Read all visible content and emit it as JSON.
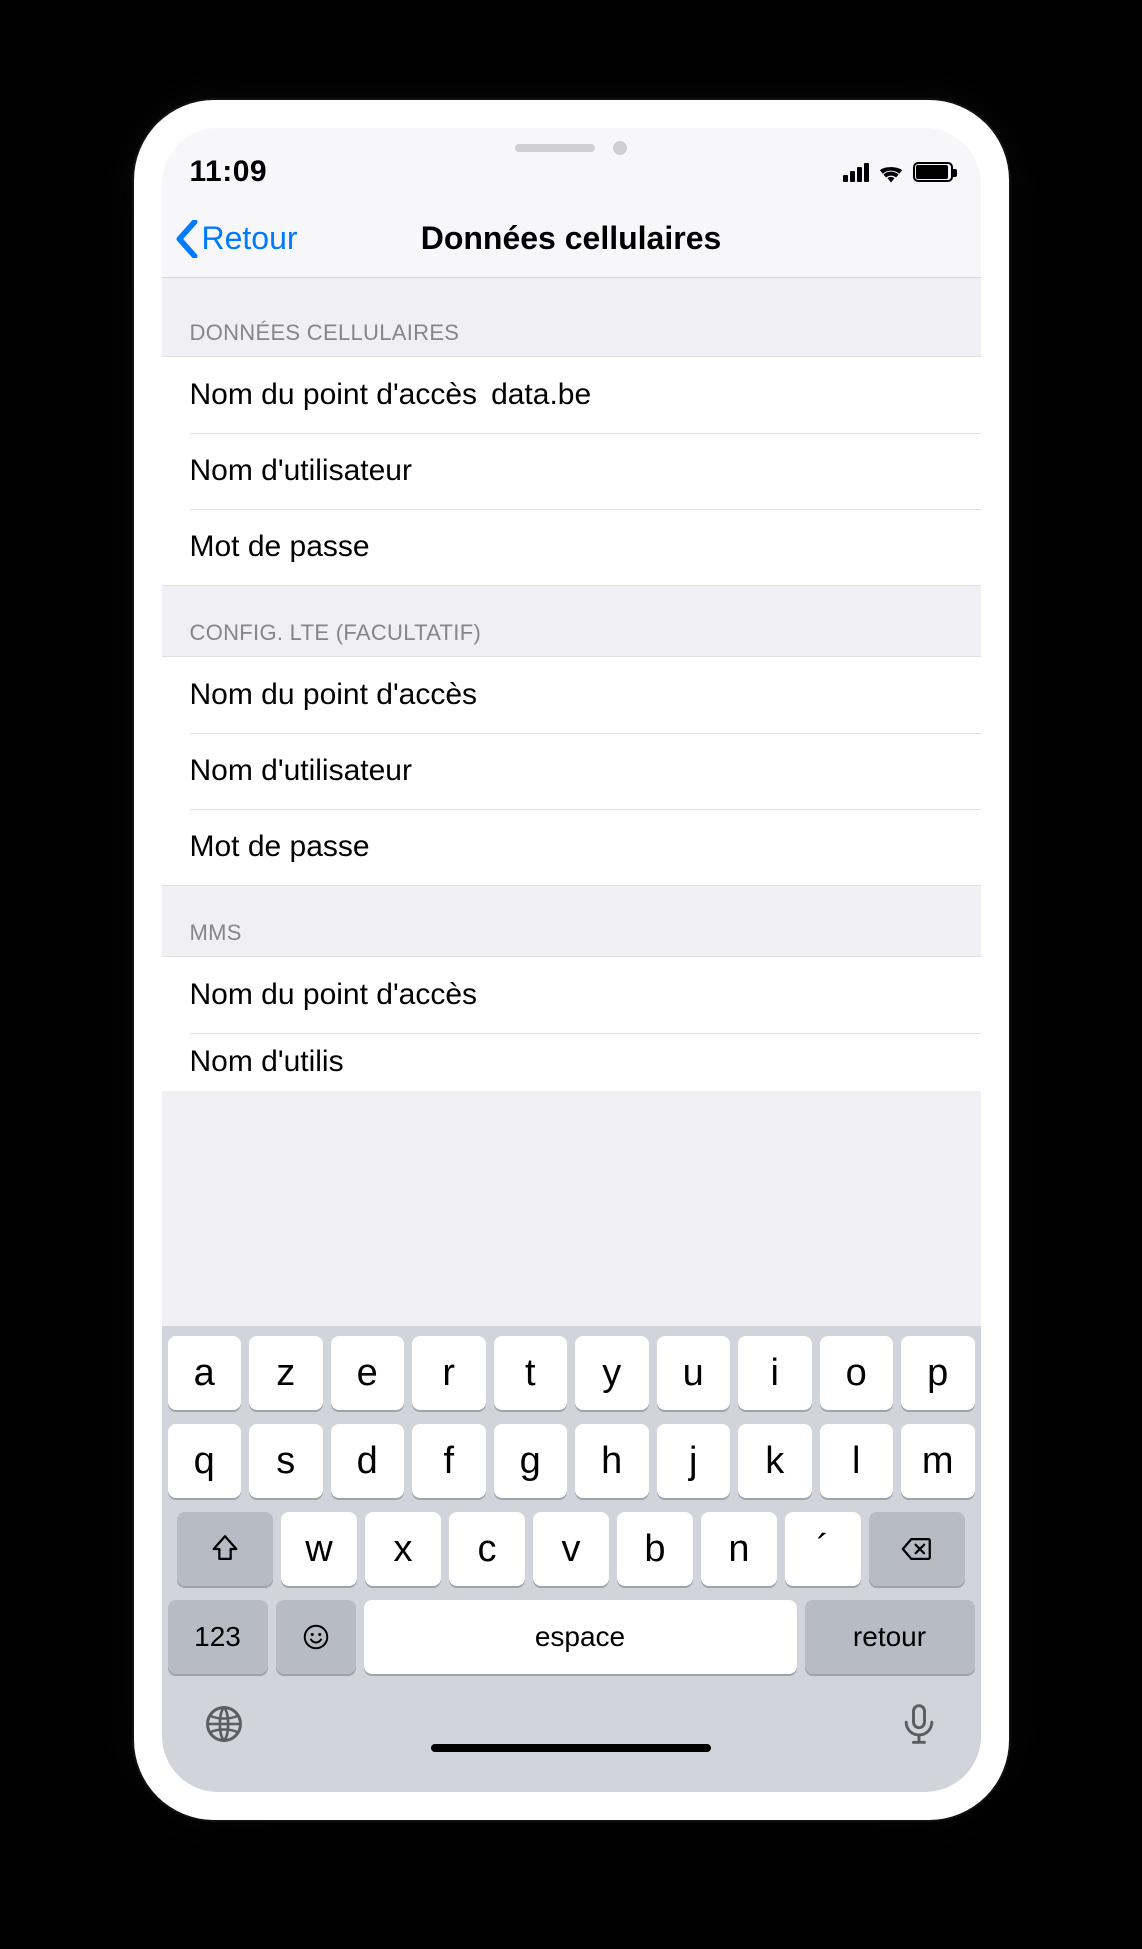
{
  "status": {
    "time": "11:09"
  },
  "nav": {
    "back": "Retour",
    "title": "Données cellulaires"
  },
  "sections": {
    "cellular": {
      "header": "DONNÉES CELLULAIRES",
      "apn_label": "Nom du point d'accès",
      "apn_value": "data.be",
      "user_label": "Nom d'utilisateur",
      "user_value": "",
      "pass_label": "Mot de passe",
      "pass_value": ""
    },
    "lte": {
      "header": "CONFIG. LTE (FACULTATIF)",
      "apn_label": "Nom du point d'accès",
      "apn_value": "",
      "user_label": "Nom d'utilisateur",
      "user_value": "",
      "pass_label": "Mot de passe",
      "pass_value": ""
    },
    "mms": {
      "header": "MMS",
      "apn_label": "Nom du point d'accès",
      "apn_value": "",
      "user_label_cut": "Nom d'utilis"
    }
  },
  "keyboard": {
    "row1": [
      "a",
      "z",
      "e",
      "r",
      "t",
      "y",
      "u",
      "i",
      "o",
      "p"
    ],
    "row2": [
      "q",
      "s",
      "d",
      "f",
      "g",
      "h",
      "j",
      "k",
      "l",
      "m"
    ],
    "row3": [
      "w",
      "x",
      "c",
      "v",
      "b",
      "n",
      "´"
    ],
    "numKey": "123",
    "space": "espace",
    "return": "retour"
  }
}
